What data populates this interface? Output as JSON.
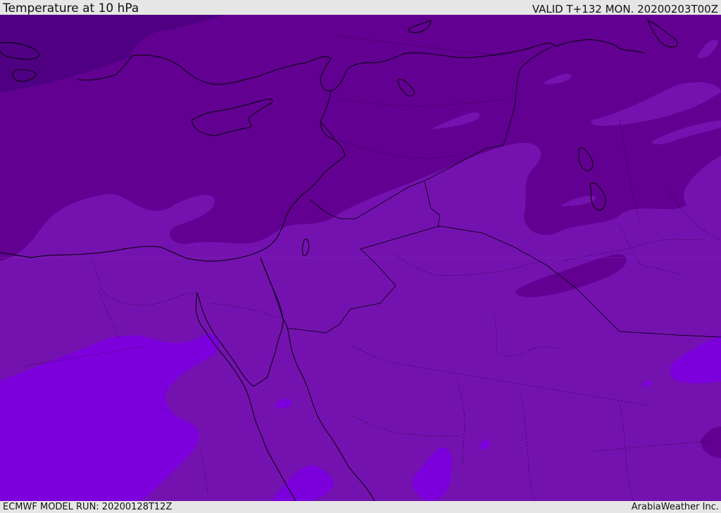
{
  "header": {
    "title": "Temperature at 10 hPa",
    "valid_time": "VALID T+132 MON. 20200203T00Z"
  },
  "footer": {
    "model_run": "ECMWF MODEL RUN: 20200128T12Z",
    "credit": "ArabiaWeather Inc."
  },
  "map": {
    "field": "temperature",
    "level": "10 hPa",
    "colors": {
      "coldest_band": "#4f0082",
      "cold_band": "#620092",
      "mid_band": "#7412b0",
      "warm_band": "#7c00dc",
      "coastline": "#000000",
      "border": "#000000"
    }
  }
}
